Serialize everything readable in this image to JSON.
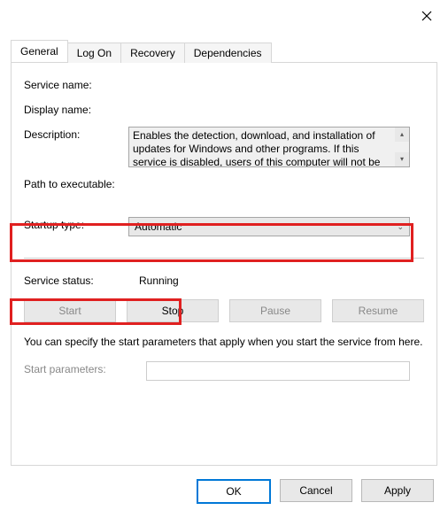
{
  "close_icon": "close",
  "tabs": {
    "items": [
      {
        "label": "General",
        "active": true
      },
      {
        "label": "Log On",
        "active": false
      },
      {
        "label": "Recovery",
        "active": false
      },
      {
        "label": "Dependencies",
        "active": false
      }
    ]
  },
  "labels": {
    "service_name": "Service name:",
    "display_name": "Display name:",
    "description": "Description:",
    "path_exec": "Path to executable:",
    "startup_type": "Startup type:",
    "service_status": "Service status:",
    "start_params": "Start parameters:"
  },
  "description_text": "Enables the detection, download, and installation of updates for Windows and other programs. If this service is disabled, users of this computer will not be",
  "startup_type_value": "Automatic",
  "service_status_value": "Running",
  "service_buttons": {
    "start": "Start",
    "stop": "Stop",
    "pause": "Pause",
    "resume": "Resume"
  },
  "hint": "You can specify the start parameters that apply when you start the service from here.",
  "dialog_buttons": {
    "ok": "OK",
    "cancel": "Cancel",
    "apply": "Apply"
  }
}
